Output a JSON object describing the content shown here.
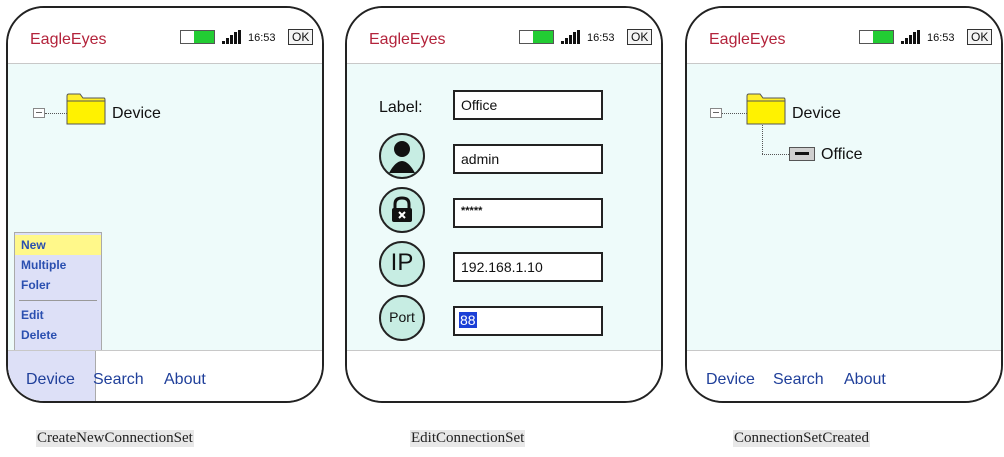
{
  "app": {
    "name": "EagleEyes",
    "time": "16:53",
    "ok_label": "OK"
  },
  "screen1": {
    "tree_root": "Device",
    "menu": [
      "New",
      "Multiple",
      "Foler",
      "Edit",
      "Delete"
    ],
    "selected_menu": "New",
    "softkeys": [
      "Device",
      "Search",
      "About"
    ],
    "caption": "CreateNewConnectionSet"
  },
  "screen2": {
    "label_text": "Label:",
    "fields": {
      "label": "Office",
      "user": "admin",
      "password": "*****",
      "ip": "192.168.1.10",
      "port": "88"
    },
    "icon_ip_text": "IP",
    "icon_port_text": "Port",
    "caption": "EditConnectionSet"
  },
  "screen3": {
    "tree_root": "Device",
    "tree_child": "Office",
    "softkeys": [
      "Device",
      "Search",
      "About"
    ],
    "caption": "ConnectionSetCreated"
  },
  "colors": {
    "accent": "#b3233b",
    "battery": "#22cc33",
    "content_bg": "#eefbfa",
    "softkey": "#1f3f9a",
    "menu_bg": "#dde0f7",
    "menu_highlight": "#fff88a",
    "icon_bg": "#c7ede3",
    "selection": "#1b3fd6"
  }
}
